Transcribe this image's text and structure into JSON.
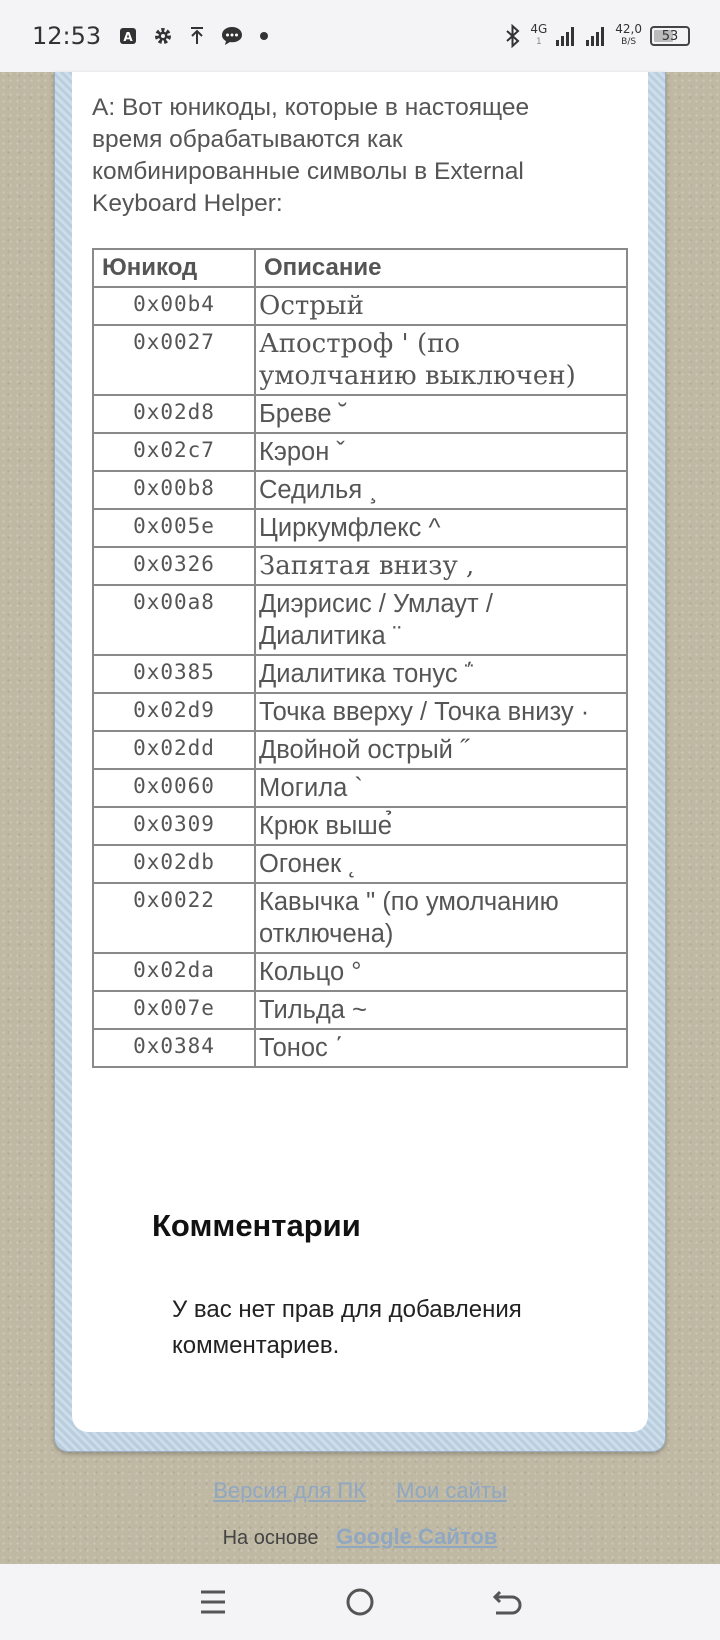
{
  "status_bar": {
    "time": "12:53",
    "network_type": "4G",
    "network_sub": "1",
    "speed_value": "42,0",
    "speed_unit": "B/S",
    "battery": "53",
    "left_icons": [
      "auto-brightness-icon",
      "gear-icon",
      "upload-icon",
      "message-icon",
      "dot-icon"
    ],
    "right_icons": [
      "bluetooth-icon",
      "signal-icon",
      "signal-icon"
    ]
  },
  "content": {
    "intro": "А: Вот юникоды, которые в настоящее время обрабатываются как комбинированные символы в External Keyboard Helper:",
    "table": {
      "headers": [
        "Юникод",
        "Описание"
      ],
      "rows": [
        {
          "code": "0x00b4",
          "desc": "Острый",
          "serif": true
        },
        {
          "code": "0x0027",
          "desc": "Апостроф ' (по умолчанию выключен)",
          "serif": true
        },
        {
          "code": "0x02d8",
          "desc": "Бреве ˘",
          "serif": false
        },
        {
          "code": "0x02c7",
          "desc": "Кэрон ˇ",
          "serif": false
        },
        {
          "code": "0x00b8",
          "desc": "Седилья ¸",
          "serif": false
        },
        {
          "code": "0x005e",
          "desc": "Циркумфлекс ^",
          "serif": false
        },
        {
          "code": "0x0326",
          "desc": "Запятая внизу ,",
          "serif": true
        },
        {
          "code": "0x00a8",
          "desc": "Диэрисис / Умлаут / Диалитика ¨",
          "serif": false
        },
        {
          "code": "0x0385",
          "desc": "Диалитика тонус ΅",
          "serif": false
        },
        {
          "code": "0x02d9",
          "desc": "Точка вверху / Точка внизу ·",
          "serif": false
        },
        {
          "code": "0x02dd",
          "desc": "Двойной острый ˝",
          "serif": false
        },
        {
          "code": "0x0060",
          "desc": "Могила `",
          "serif": false
        },
        {
          "code": "0x0309",
          "desc": "Крюк выше̉",
          "serif": false
        },
        {
          "code": "0x02db",
          "desc": "Огонек ˛",
          "serif": false
        },
        {
          "code": "0x0022",
          "desc": "Кавычка \" (по умолчанию отключена)",
          "serif": false
        },
        {
          "code": "0x02da",
          "desc": "Кольцо °",
          "serif": false
        },
        {
          "code": "0x007e",
          "desc": "Тильда ~",
          "serif": false
        },
        {
          "code": "0x0384",
          "desc": "Тонос ΄",
          "serif": false
        }
      ]
    },
    "comments_heading": "Комментарии",
    "no_rights": "У вас нет прав для добавления комментариев."
  },
  "footer": {
    "pc_version": "Версия для ПК",
    "my_sites": "Мои сайты",
    "based_on": "На основе",
    "google_sites": "Google Сайтов"
  },
  "nav": {
    "icons": [
      "menu-icon",
      "home-icon",
      "back-icon"
    ]
  }
}
